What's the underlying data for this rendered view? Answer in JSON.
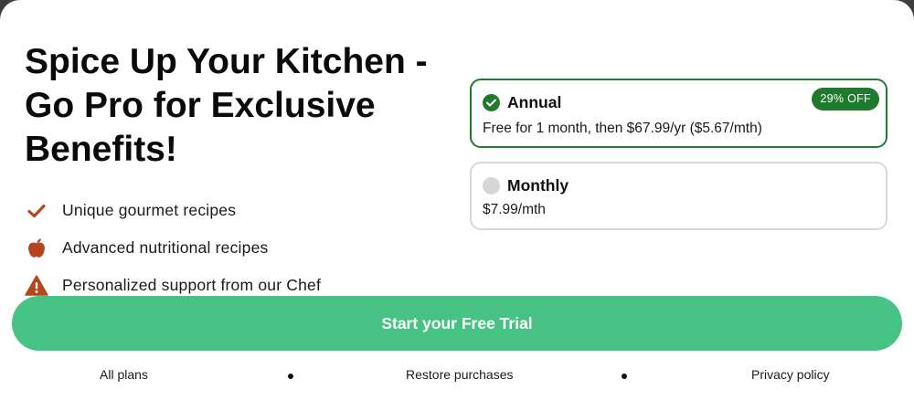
{
  "headline": "Spice Up Your Kitchen - Go Pro for Exclusive Benefits!",
  "benefits": [
    {
      "icon": "check-icon",
      "label": "Unique gourmet recipes"
    },
    {
      "icon": "apple-icon",
      "label": "Advanced nutritional recipes"
    },
    {
      "icon": "warning-icon",
      "label": "Personalized support from our Chef"
    }
  ],
  "plans": {
    "annual": {
      "name": "Annual",
      "price": "Free for 1 month, then $67.99/yr ($5.67/mth)",
      "badge": "29% OFF",
      "selected": true
    },
    "monthly": {
      "name": "Monthly",
      "price": "$7.99/mth",
      "selected": false
    }
  },
  "cta_label": "Start your Free Trial",
  "footer": {
    "all_plans": "All plans",
    "restore": "Restore purchases",
    "privacy": "Privacy policy"
  },
  "colors": {
    "accent_green": "#1f7a2e",
    "cta_green": "#46c384",
    "icon_rust": "#b4451f"
  }
}
